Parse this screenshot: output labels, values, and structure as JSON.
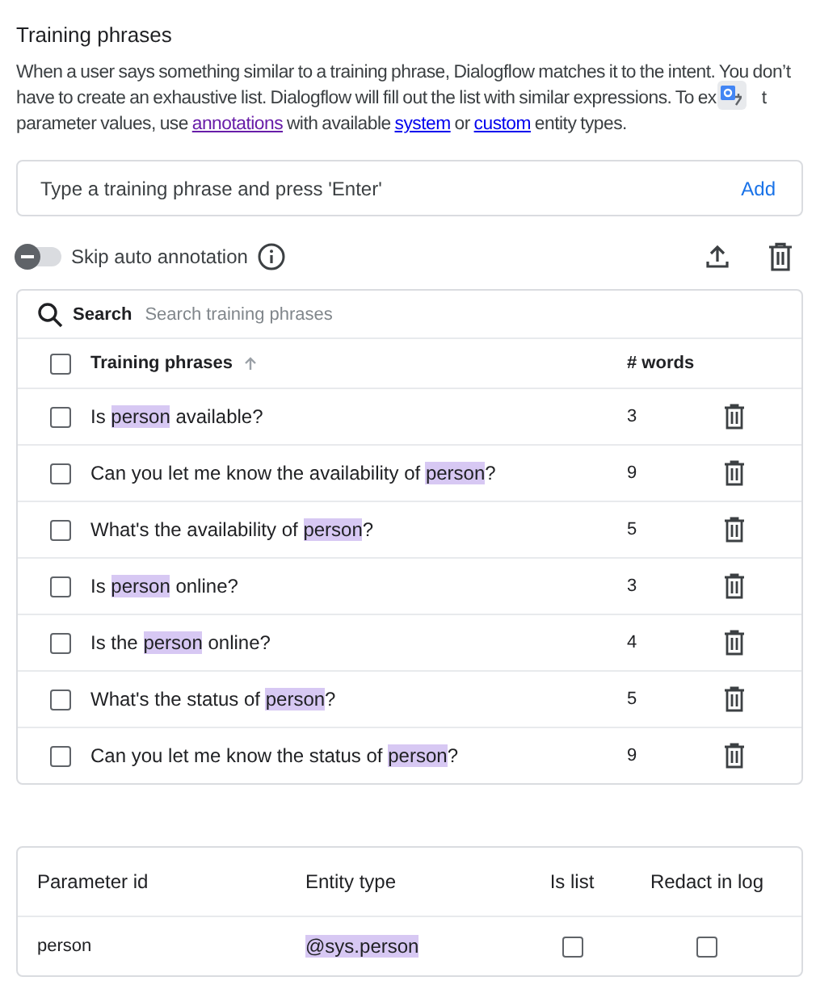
{
  "section_title": "Training phrases",
  "description": {
    "before": "When a user says something similar to a training phrase, Dialogflow matches it to the intent. You don’t have to create an exhaustive list. Dialogflow will fill out the list with similar expressions. To ex",
    "after": "t parameter values, use ",
    "link1": "annotations",
    "mid1": " with available ",
    "link2": "system",
    "mid2": " or ",
    "link3": "custom",
    "end": " entity types."
  },
  "phrase_input": {
    "placeholder": "Type a training phrase and press 'Enter'",
    "add_button": "Add"
  },
  "skip_auto_annotation": {
    "label": "Skip auto annotation",
    "on": false
  },
  "search": {
    "label": "Search",
    "placeholder": "Search training phrases"
  },
  "phrases_table": {
    "select_all_checked": false,
    "columns": [
      "Training phrases",
      "# words"
    ],
    "rows": [
      {
        "checked": false,
        "parts": [
          {
            "text": "Is ",
            "entity": false
          },
          {
            "text": "person",
            "entity": true
          },
          {
            "text": " available?",
            "entity": false
          }
        ],
        "words": "3"
      },
      {
        "checked": false,
        "parts": [
          {
            "text": "Can you let me know the availability of ",
            "entity": false
          },
          {
            "text": "person",
            "entity": true
          },
          {
            "text": "?",
            "entity": false
          }
        ],
        "words": "9"
      },
      {
        "checked": false,
        "parts": [
          {
            "text": "What's the availability of ",
            "entity": false
          },
          {
            "text": "person",
            "entity": true
          },
          {
            "text": "?",
            "entity": false
          }
        ],
        "words": "5"
      },
      {
        "checked": false,
        "parts": [
          {
            "text": "Is ",
            "entity": false
          },
          {
            "text": "person",
            "entity": true
          },
          {
            "text": " online?",
            "entity": false
          }
        ],
        "words": "3"
      },
      {
        "checked": false,
        "parts": [
          {
            "text": "Is the ",
            "entity": false
          },
          {
            "text": "person",
            "entity": true
          },
          {
            "text": " online?",
            "entity": false
          }
        ],
        "words": "4"
      },
      {
        "checked": false,
        "parts": [
          {
            "text": "What's the status of ",
            "entity": false
          },
          {
            "text": "person",
            "entity": true
          },
          {
            "text": "?",
            "entity": false
          }
        ],
        "words": "5"
      },
      {
        "checked": false,
        "parts": [
          {
            "text": "Can you let me know the status of ",
            "entity": false
          },
          {
            "text": "person",
            "entity": true
          },
          {
            "text": "?",
            "entity": false
          }
        ],
        "words": "9"
      }
    ]
  },
  "parameters_table": {
    "columns": [
      "Parameter id",
      "Entity type",
      "Is list",
      "Redact in log"
    ],
    "rows": [
      {
        "id": "person",
        "entity_type": "@sys.person",
        "is_list": false,
        "redact": false
      }
    ]
  }
}
